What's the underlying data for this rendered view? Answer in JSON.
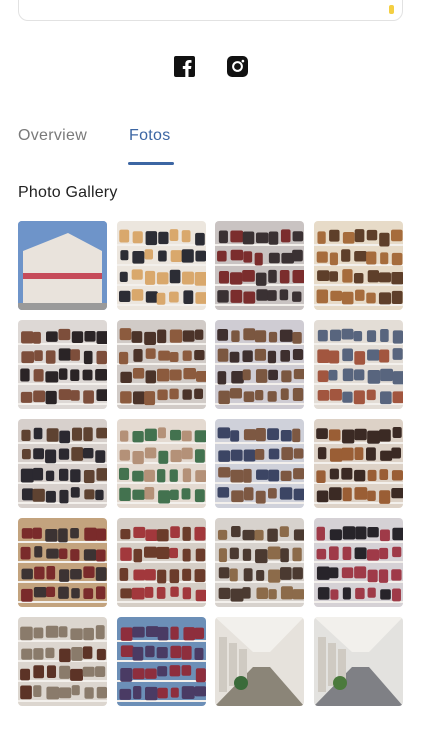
{
  "social": {
    "icons": [
      "facebook-icon",
      "instagram-icon"
    ]
  },
  "tabs": [
    {
      "label": "Overview",
      "active": false
    },
    {
      "label": "Fotos",
      "active": true
    }
  ],
  "accent_color": "#3c66a3",
  "gallery": {
    "title": "Photo Gallery",
    "photos": [
      {
        "subject": "storefront-exterior",
        "colors": [
          "#6e94c9",
          "#e9e3dc",
          "#c64b5a"
        ]
      },
      {
        "subject": "hanging-clothes",
        "colors": [
          "#ece6de",
          "#2c2d35",
          "#d9a86c"
        ]
      },
      {
        "subject": "handbag-wall",
        "colors": [
          "#c9c3c2",
          "#7b2d2d",
          "#3a3133"
        ]
      },
      {
        "subject": "bags-and-belts",
        "colors": [
          "#e7dbc8",
          "#5e3f2a",
          "#a66c3c"
        ]
      },
      {
        "subject": "black-handbags",
        "colors": [
          "#ddd8d5",
          "#2a2426",
          "#7d4e3b"
        ]
      },
      {
        "subject": "wallet-display",
        "colors": [
          "#d1cbc7",
          "#4b3329",
          "#8c5b3e"
        ]
      },
      {
        "subject": "bags-on-pegs",
        "colors": [
          "#cfccd3",
          "#3e2f2e",
          "#7b5740"
        ]
      },
      {
        "subject": "hats-display",
        "colors": [
          "#e3ddd6",
          "#58657e",
          "#a2563f"
        ]
      },
      {
        "subject": "mixed-goods",
        "colors": [
          "#d7d0cc",
          "#5e4231",
          "#2b2930"
        ]
      },
      {
        "subject": "lace-garments",
        "colors": [
          "#e4dad1",
          "#b49178",
          "#43724f"
        ]
      },
      {
        "subject": "blue-handbags",
        "colors": [
          "#cfd1da",
          "#3c4564",
          "#7d5842"
        ]
      },
      {
        "subject": "leather-bags",
        "colors": [
          "#ddd2c7",
          "#3b2a24",
          "#9a5e35"
        ]
      },
      {
        "subject": "jackets-rack",
        "colors": [
          "#c3a37e",
          "#7a2b2b",
          "#3c3333"
        ]
      },
      {
        "subject": "hats-and-bags",
        "colors": [
          "#d5cec6",
          "#6b3c2b",
          "#a2383c"
        ]
      },
      {
        "subject": "shop-corner",
        "colors": [
          "#d7d2cd",
          "#4b3a31",
          "#8c6b4a"
        ]
      },
      {
        "subject": "jackets-and-bags",
        "colors": [
          "#d5d1d5",
          "#27242a",
          "#9f3a48"
        ]
      },
      {
        "subject": "handbag-shelves",
        "colors": [
          "#dcd6cf",
          "#5c3326",
          "#8a7b6b"
        ]
      },
      {
        "subject": "colorful-shop",
        "colors": [
          "#6c8fb7",
          "#4a3b64",
          "#8e2e3d"
        ]
      },
      {
        "subject": "mall-corridor",
        "colors": [
          "#e6e2dc",
          "#8b8578",
          "#3a6b3a"
        ]
      },
      {
        "subject": "mall-hallway",
        "colors": [
          "#e3e2df",
          "#7f8085",
          "#4b7a3c"
        ]
      }
    ]
  }
}
